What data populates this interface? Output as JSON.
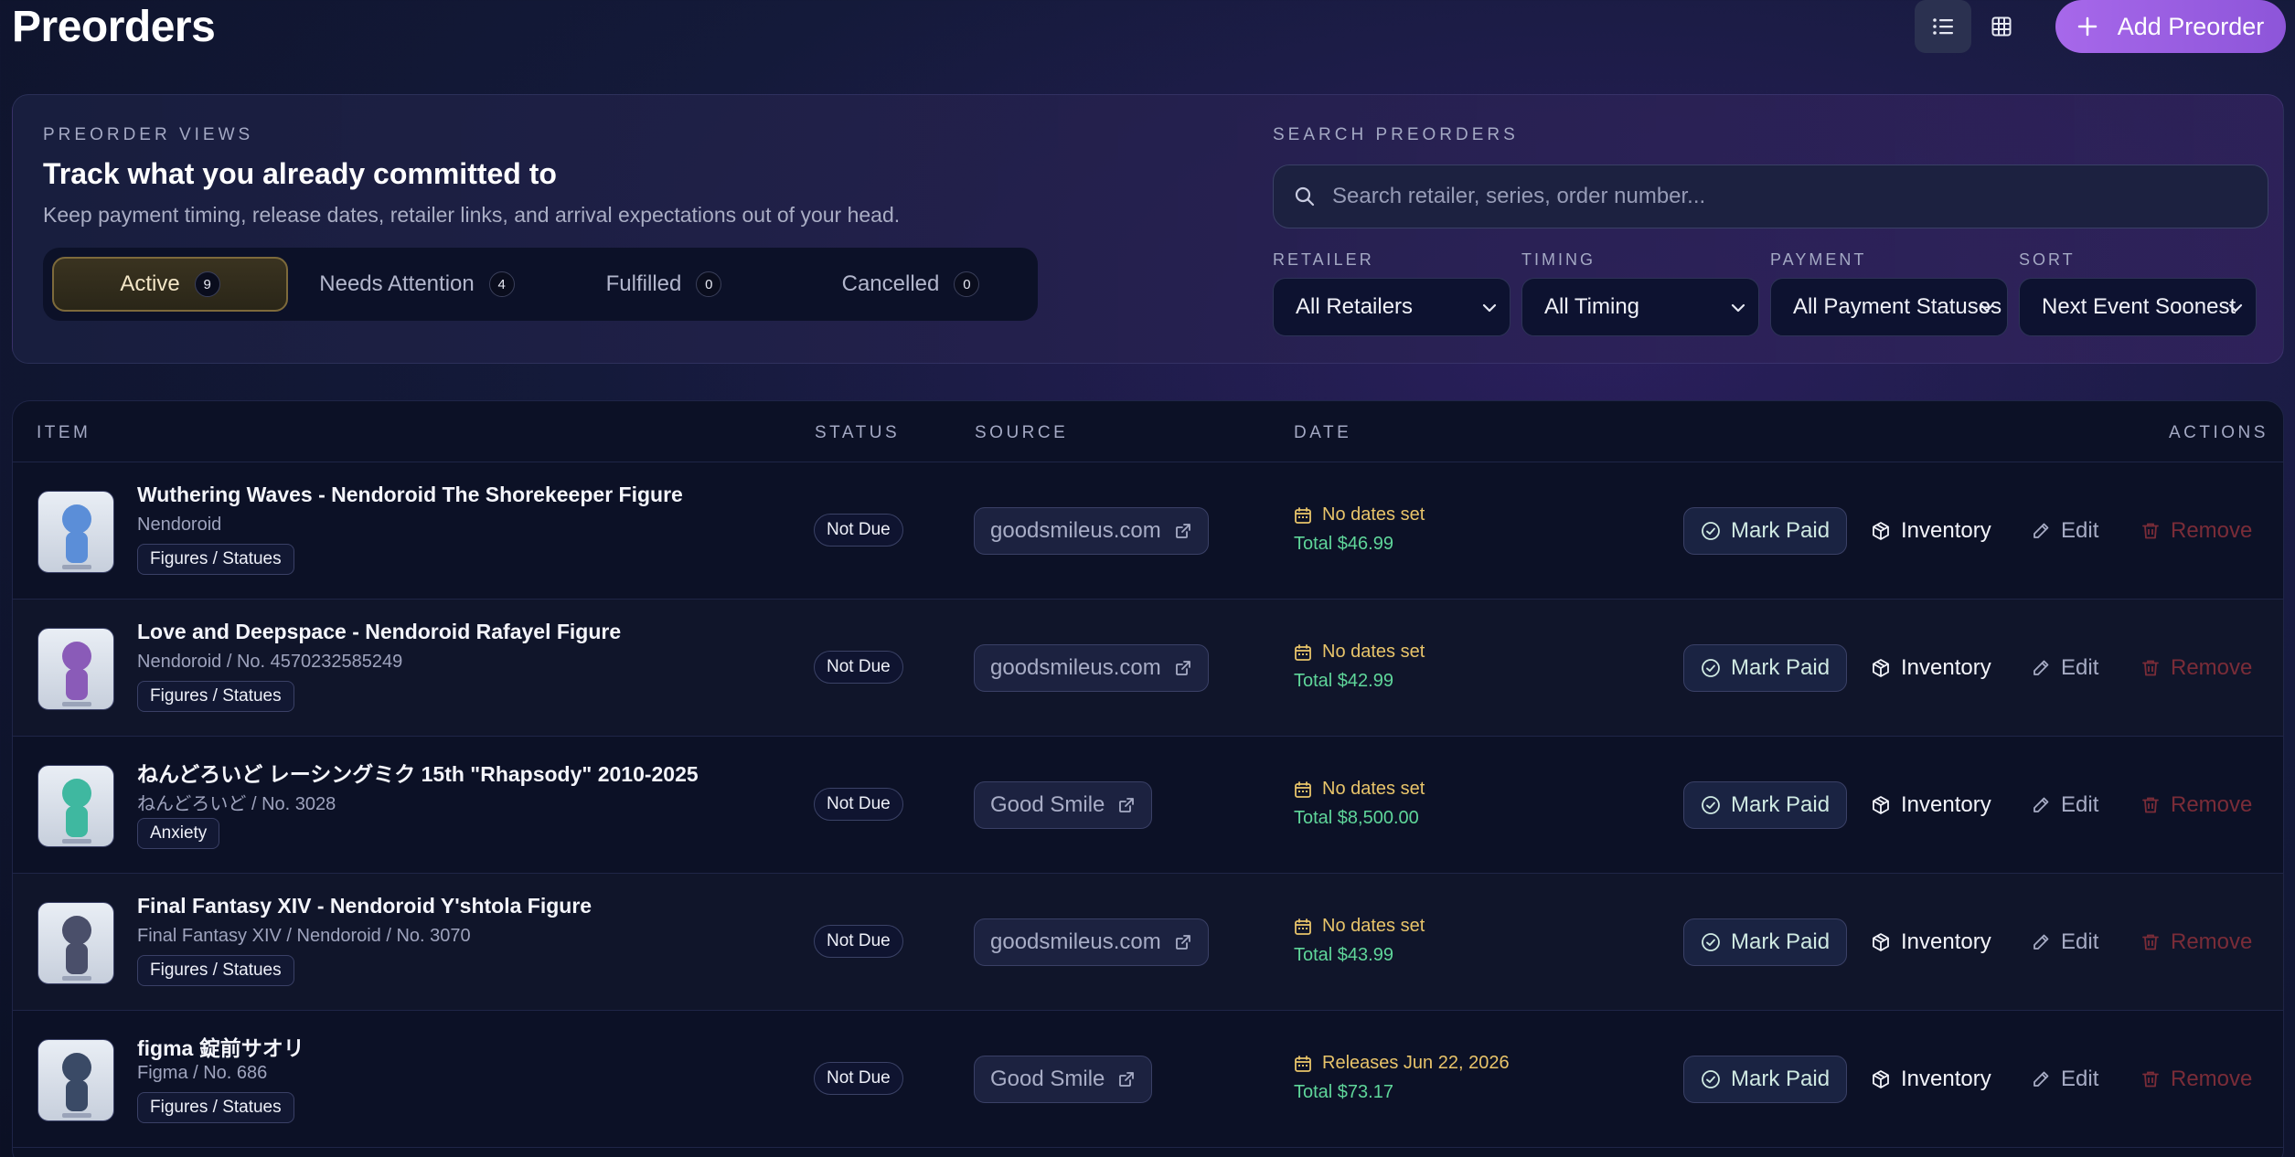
{
  "header": {
    "title": "Preorders",
    "add_label": "Add Preorder"
  },
  "view_toggle": [
    {
      "name": "list-view-button",
      "icon": "list-icon",
      "active": true
    },
    {
      "name": "grid-view-button",
      "icon": "grid-icon",
      "active": false
    }
  ],
  "panel": {
    "overline": "PREORDER VIEWS",
    "heading": "Track what you already committed to",
    "subheading": "Keep payment timing, release dates, retailer links, and arrival expectations out of your head.",
    "tabs": [
      {
        "label": "Active",
        "count": "9",
        "active": true
      },
      {
        "label": "Needs Attention",
        "count": "4",
        "active": false
      },
      {
        "label": "Fulfilled",
        "count": "0",
        "active": false
      },
      {
        "label": "Cancelled",
        "count": "0",
        "active": false
      }
    ]
  },
  "search": {
    "overline": "SEARCH PREORDERS",
    "placeholder": "Search retailer, series, order number..."
  },
  "filters": [
    {
      "label": "RETAILER",
      "value": "All Retailers"
    },
    {
      "label": "TIMING",
      "value": "All Timing"
    },
    {
      "label": "PAYMENT",
      "value": "All Payment Statuses"
    },
    {
      "label": "SORT",
      "value": "Next Event Soonest"
    }
  ],
  "table": {
    "columns": {
      "item": "ITEM",
      "status": "STATUS",
      "source": "SOURCE",
      "date": "DATE",
      "actions": "ACTIONS"
    },
    "action_labels": {
      "paid": "Mark Paid",
      "inventory": "Inventory",
      "edit": "Edit",
      "remove": "Remove"
    },
    "rows": [
      {
        "title": "Wuthering Waves - Nendoroid The Shorekeeper Figure",
        "subtitle": "Nendoroid",
        "tag": "Figures / Statues",
        "status": "Not Due",
        "source": "goodsmileus.com",
        "date": "No dates set",
        "total": "Total $46.99",
        "accent": "#5b8ed8"
      },
      {
        "title": "Love and Deepspace - Nendoroid Rafayel Figure",
        "subtitle": "Nendoroid / No. 4570232585249",
        "tag": "Figures / Statues",
        "status": "Not Due",
        "source": "goodsmileus.com",
        "date": "No dates set",
        "total": "Total $42.99",
        "accent": "#8a5bb8"
      },
      {
        "title": "ねんどろいど レーシングミク 15th \"Rhapsody\" 2010-2025",
        "subtitle": "ねんどろいど / No. 3028",
        "tag": "Anxiety",
        "status": "Not Due",
        "source": "Good Smile",
        "date": "No dates set",
        "total": "Total $8,500.00",
        "accent": "#3fb8a0"
      },
      {
        "title": "Final Fantasy XIV - Nendoroid Y'shtola Figure",
        "subtitle": "Final Fantasy XIV / Nendoroid / No. 3070",
        "tag": "Figures / Statues",
        "status": "Not Due",
        "source": "goodsmileus.com",
        "date": "No dates set",
        "total": "Total $43.99",
        "accent": "#4a4f6a"
      },
      {
        "title": "figma 錠前サオリ",
        "subtitle": "Figma / No. 686",
        "tag": "Figures / Statues",
        "status": "Not Due",
        "source": "Good Smile",
        "date": "Releases Jun 22, 2026",
        "total": "Total $73.17",
        "accent": "#3a4a66"
      }
    ]
  },
  "colors": {
    "accent": "#a768ea",
    "date": "#e8c46a",
    "total": "#5fd69a",
    "remove": "#7a2c38"
  }
}
